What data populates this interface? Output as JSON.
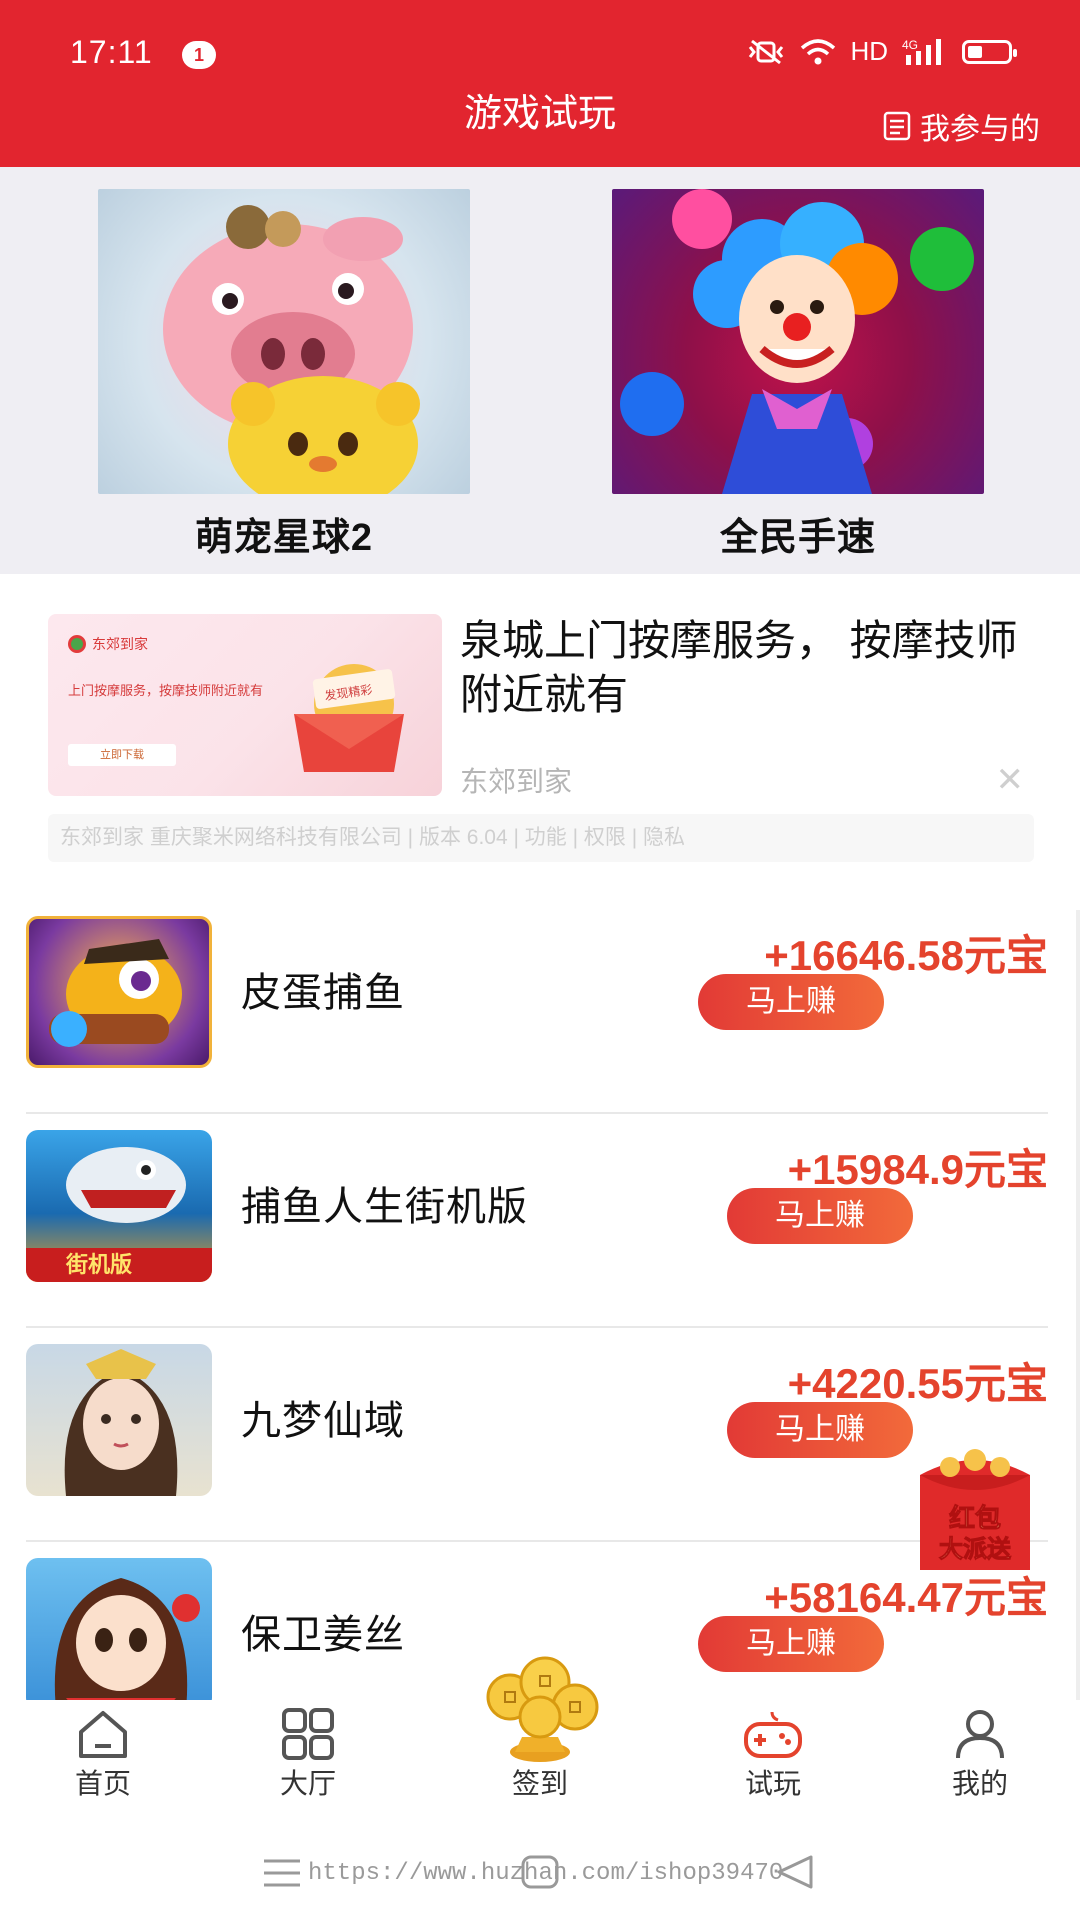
{
  "status_bar": {
    "time": "17:11",
    "notification_count": "1",
    "hd": "HD",
    "network": "4G"
  },
  "header": {
    "title": "游戏试玩",
    "my_joined": "我参与的"
  },
  "featured": [
    {
      "name": "萌宠星球2"
    },
    {
      "name": "全民手速"
    }
  ],
  "ad": {
    "brand": "东郊到家",
    "slogan": "上门按摩服务，按摩技师附近就有",
    "download": "立即下载",
    "envelope_text": "发现精彩",
    "title": "泉城上门按摩服务，  按摩技师附近就有",
    "source": "东郊到家",
    "info": "东郊到家 重庆聚米网络科技有限公司 | 版本 6.04 | 功能 | 权限 | 隐私"
  },
  "games": [
    {
      "name": "皮蛋捕鱼",
      "reward": "+16646.58元宝",
      "button": "马上赚"
    },
    {
      "name": "捕鱼人生街机版",
      "reward": "+15984.9元宝",
      "button": "马上赚",
      "icon_text": "街机版"
    },
    {
      "name": "九梦仙域",
      "reward": "+4220.55元宝",
      "button": "马上赚"
    },
    {
      "name": "保卫姜丝",
      "reward": "+58164.47元宝",
      "button": "马上赚"
    }
  ],
  "redpack": {
    "line1": "红包",
    "line2": "大派送"
  },
  "bottom_nav": [
    {
      "label": "首页",
      "icon": "home-icon"
    },
    {
      "label": "大厅",
      "icon": "grid-icon"
    },
    {
      "label": "签到",
      "icon": "coins-icon"
    },
    {
      "label": "试玩",
      "icon": "gamepad-icon",
      "active": true
    },
    {
      "label": "我的",
      "icon": "user-icon"
    }
  ],
  "watermark": "https://www.huzhan.com/ishop39470",
  "colors": {
    "brand_red": "#e2252f",
    "reward_orange": "#e4432d",
    "button_gradient_start": "#e23a36",
    "button_gradient_end": "#f26a3a"
  }
}
